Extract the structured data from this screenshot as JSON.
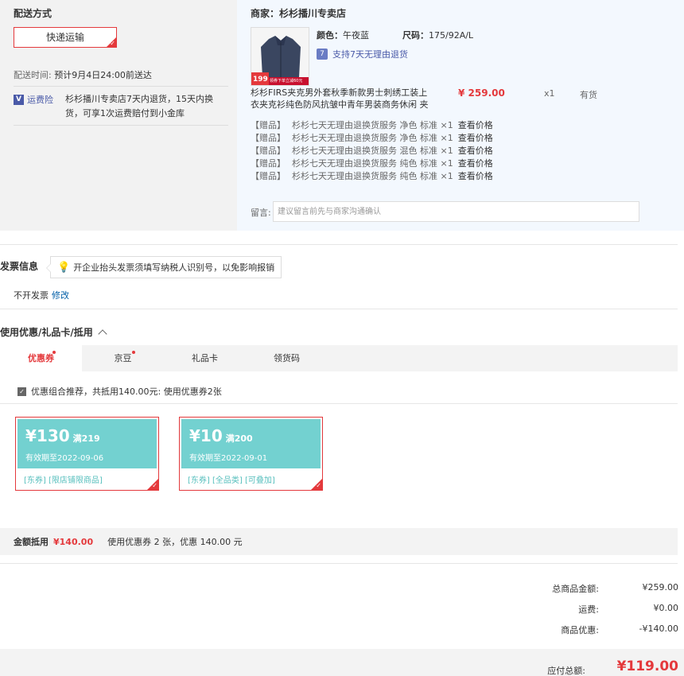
{
  "shipping": {
    "title": "配送方式",
    "method": "快递运输",
    "time_label": "配送时间:",
    "time_value": "预计9月4日24:00前送达",
    "insurance_icon": "V",
    "insurance_label": "运费险",
    "insurance_text": "杉杉播川专卖店7天内退货，15天内换货，可享1次运费赔付到小金库"
  },
  "order": {
    "merchant": "商家：杉杉播川专卖店",
    "color_label": "颜色：",
    "color_value": "午夜蓝",
    "size_label": "尺码：",
    "size_value": "175/92A/L",
    "return_icon": "7",
    "return_text": "支持7天无理由退货",
    "product_name": "杉杉FIRS夹克男外套秋季新款男士刺绣工装上衣夹克衫纯色防风抗皱中青年男装商务休闲 ⁠夹",
    "price": "¥ 259.00",
    "qty": "x1",
    "stock": "有货",
    "img_badge_price": "199",
    "img_badge_text": "领券下单立减60元",
    "gifts": [
      {
        "tag": "【赠品】",
        "name": "杉杉七天无理由退换货服务 净色 标准 ×1",
        "link": "查看价格"
      },
      {
        "tag": "【赠品】",
        "name": "杉杉七天无理由退换货服务 净色 标准 ×1",
        "link": "查看价格"
      },
      {
        "tag": "【赠品】",
        "name": "杉杉七天无理由退换货服务 混色 标准 ×1",
        "link": "查看价格"
      },
      {
        "tag": "【赠品】",
        "name": "杉杉七天无理由退换货服务 纯色 标准 ×1",
        "link": "查看价格"
      },
      {
        "tag": "【赠品】",
        "name": "杉杉七天无理由退换货服务 纯色 标准 ×1",
        "link": "查看价格"
      }
    ],
    "note_label": "留言:",
    "note_placeholder": "建议留言前先与商家沟通确认"
  },
  "invoice": {
    "title": "发票信息",
    "tip": "开企业抬头发票须填写纳税人识别号，以免影响报销",
    "status": "不开发票",
    "edit": "修改"
  },
  "discount": {
    "title": "使用优惠/礼品卡/抵用",
    "tabs": [
      {
        "label": "优惠券",
        "dot": true
      },
      {
        "label": "京豆",
        "dot": true
      },
      {
        "label": "礼品卡",
        "dot": false
      },
      {
        "label": "领货码",
        "dot": false
      }
    ],
    "combo_text": "优惠组合推荐，共抵用140.00元: 使用优惠券2张",
    "coupons": [
      {
        "amount": "¥130",
        "condition": "满219",
        "valid": "有效期至2022-09-06",
        "tags": "[东券] [限店铺限商品]"
      },
      {
        "amount": "¥10",
        "condition": "满200",
        "valid": "有效期至2022-09-01",
        "tags": "[东券] [全品类] [可叠加]"
      }
    ],
    "summary_label": "金额抵用",
    "summary_value": "¥140.00",
    "summary_note": "使用优惠券 2 张，优惠 140.00 元"
  },
  "totals": {
    "rows": [
      {
        "label": "总商品金额:",
        "value": "¥259.00"
      },
      {
        "label": "运费:",
        "value": "¥0.00"
      },
      {
        "label": "商品优惠:",
        "value": "-¥140.00"
      }
    ],
    "pay_label": "应付总额:",
    "pay_value": "¥119.00"
  },
  "colors": {
    "accent": "#e4393c",
    "coupon": "#73d1d0",
    "link": "#005ea7"
  }
}
